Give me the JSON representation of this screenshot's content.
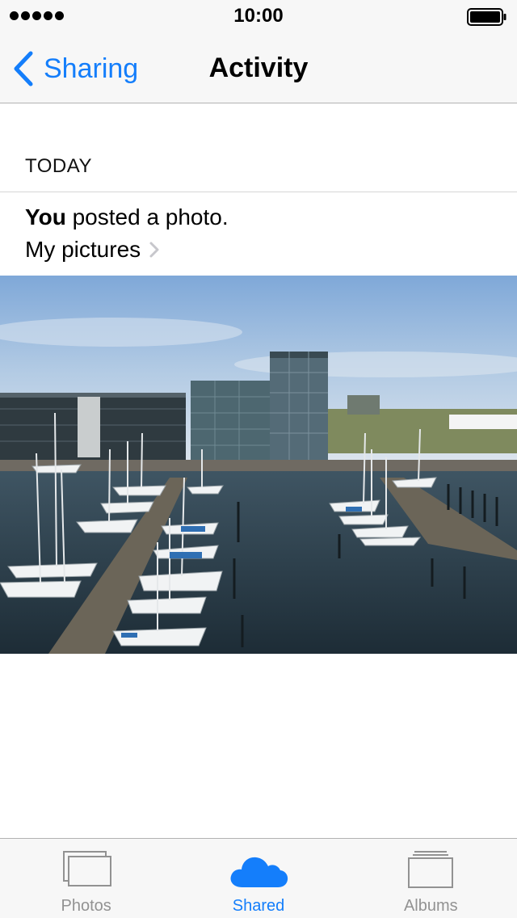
{
  "status_bar": {
    "time": "10:00"
  },
  "nav": {
    "back_label": "Sharing",
    "title": "Activity"
  },
  "section": {
    "header": "TODAY"
  },
  "post": {
    "actor": "You",
    "action": " posted a photo.",
    "album_name": "My pictures"
  },
  "tabs": [
    {
      "label": "Photos",
      "icon": "photos-icon",
      "active": false
    },
    {
      "label": "Shared",
      "icon": "cloud-icon",
      "active": true
    },
    {
      "label": "Albums",
      "icon": "albums-icon",
      "active": false
    }
  ],
  "colors": {
    "accent": "#147efb",
    "inactive_tab": "#929292",
    "bar_background": "#f7f7f7"
  }
}
